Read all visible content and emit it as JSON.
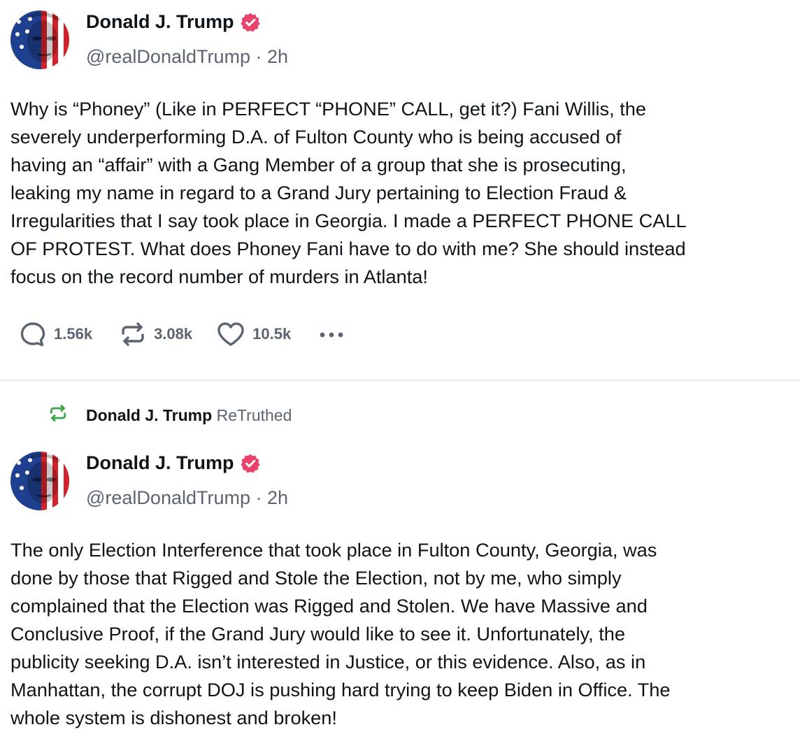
{
  "post1": {
    "author_name": "Donald J. Trump",
    "handle": "@realDonaldTrump",
    "separator": "·",
    "time": "2h",
    "body_lines": [
      "Why is “Phoney” (Like in PERFECT “PHONE” CALL, get it?) Fani Willis, the",
      "severely underperforming D.A. of Fulton County who is being accused of",
      "having an “affair” with a Gang Member of a group that she is prosecuting,",
      "leaking my name in regard to a Grand Jury pertaining to Election Fraud &",
      "Irregularities that I say took place in Georgia. I made a PERFECT PHONE CALL",
      "OF PROTEST. What does Phoney Fani have to do with me? She should instead",
      "focus on the record number of murders in Atlanta!"
    ],
    "actions": {
      "reply_count": "1.56k",
      "retruth_count": "3.08k",
      "like_count": "10.5k"
    }
  },
  "retruth_banner": {
    "name": "Donald J. Trump",
    "label": "ReTruthed"
  },
  "post2": {
    "author_name": "Donald J. Trump",
    "handle": "@realDonaldTrump",
    "separator": "·",
    "time": "2h",
    "body_lines": [
      "The only Election Interference that took place in Fulton County, Georgia, was",
      "done by those that Rigged and Stole the Election, not by me, who simply",
      "complained that the Election was Rigged and Stolen. We have Massive and",
      "Conclusive Proof, if the Grand Jury would like to see it. Unfortunately, the",
      "publicity seeking D.A. isn’t interested in Justice, or this evidence. Also, as in",
      "Manhattan, the corrupt DOJ is pushing hard trying to keep Biden in Office. The",
      "whole system is dishonest and broken!"
    ]
  },
  "icons": {
    "verified": "verified-badge-icon",
    "reply": "speech-bubble-icon",
    "retruth": "retruth-arrows-icon",
    "like": "heart-icon",
    "more": "more-dots-icon"
  },
  "colors": {
    "verified_badge": "#e8446b",
    "retruth_green": "#3aa64a",
    "muted_text": "#5b6470",
    "primary_text": "#0f1419"
  }
}
